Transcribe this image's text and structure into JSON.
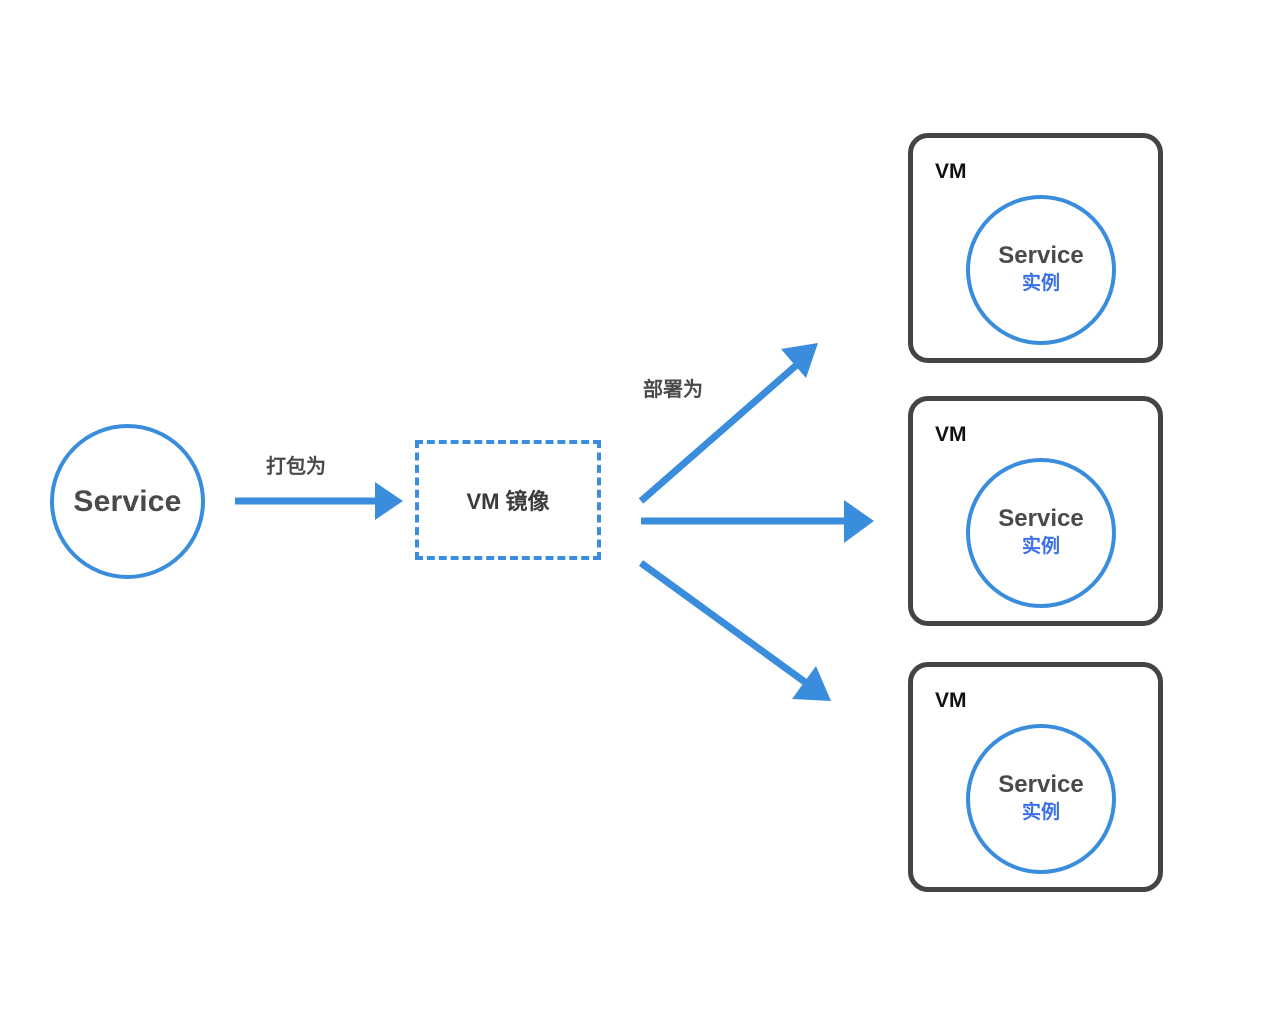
{
  "diagram": {
    "title_text": "",
    "colors": {
      "accent_blue": "#3a8ddd",
      "instance_blue": "#3b70e8",
      "dark_text": "#4a4a4a",
      "box_border": "#444444",
      "background": "#ffffff"
    },
    "source": {
      "label": "Service",
      "shape": "circle"
    },
    "artifact": {
      "label": "VM 镜像",
      "shape": "dashed-rectangle"
    },
    "edges": {
      "package_label": "打包为",
      "deploy_label": "部署为"
    },
    "vms": [
      {
        "title": "VM",
        "instance_name": "Service",
        "instance_sub": "实例"
      },
      {
        "title": "VM",
        "instance_name": "Service",
        "instance_sub": "实例"
      },
      {
        "title": "VM",
        "instance_name": "Service",
        "instance_sub": "实例"
      }
    ]
  }
}
